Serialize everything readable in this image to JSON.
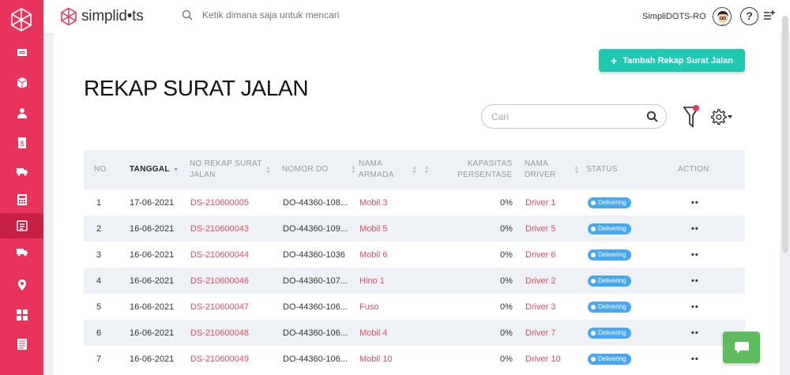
{
  "brand": {
    "name": "simplid•ts"
  },
  "topbar": {
    "search_placeholder": "Ketik dimana saja untuk mencari",
    "user_name": "SimpliDOTS-RO",
    "help_label": "?"
  },
  "page": {
    "title": "REKAP SURAT JALAN",
    "add_button_label": "Tambah Rekap Surat Jalan",
    "search_placeholder": "Cari"
  },
  "table": {
    "headers": {
      "no": "NO",
      "tanggal": "TANGGAL",
      "no_rekap_1": "NO REKAP SURAT",
      "no_rekap_2": "JALAN",
      "nomor_do": "NOMOR DO",
      "armada_1": "NAMA",
      "armada_2": "ARMADA",
      "kapasitas_1": "KAPASITAS",
      "kapasitas_2": "PERSENTASE",
      "driver_1": "NAMA",
      "driver_2": "DRIVER",
      "status": "STATUS",
      "action": "ACTION"
    },
    "rows": [
      {
        "no": "1",
        "tanggal": "17-06-2021",
        "rekap": "DS-210600005",
        "do": "DO-44360-108...",
        "armada": "Mobil 3",
        "kapasitas": "0%",
        "driver": "Driver 1",
        "status": "Delivering",
        "action": "••"
      },
      {
        "no": "2",
        "tanggal": "16-06-2021",
        "rekap": "DS-210600043",
        "do": "DO-44360-109...",
        "armada": "Mobil 5",
        "kapasitas": "0%",
        "driver": "Driver 5",
        "status": "Delivering",
        "action": "••"
      },
      {
        "no": "3",
        "tanggal": "16-06-2021",
        "rekap": "DS-210600044",
        "do": "DO-44360-1036",
        "armada": "Mobil 6",
        "kapasitas": "0%",
        "driver": "Driver 6",
        "status": "Delivering",
        "action": "••"
      },
      {
        "no": "4",
        "tanggal": "16-06-2021",
        "rekap": "DS-210600046",
        "do": "DO-44360-107...",
        "armada": "Hino 1",
        "kapasitas": "0%",
        "driver": "Driver 2",
        "status": "Delivering",
        "action": "••"
      },
      {
        "no": "5",
        "tanggal": "16-06-2021",
        "rekap": "DS-210600047",
        "do": "DO-44360-106...",
        "armada": "Fuso",
        "kapasitas": "0%",
        "driver": "Driver 3",
        "status": "Delivering",
        "action": "••"
      },
      {
        "no": "6",
        "tanggal": "16-06-2021",
        "rekap": "DS-210600048",
        "do": "DO-44360-106...",
        "armada": "Mobil 4",
        "kapasitas": "0%",
        "driver": "Driver 7",
        "status": "Delivering",
        "action": "••"
      },
      {
        "no": "7",
        "tanggal": "16-06-2021",
        "rekap": "DS-210600049",
        "do": "DO-44360-106...",
        "armada": "Mobil 10",
        "kapasitas": "0%",
        "driver": "Driver 10",
        "status": "Delivering",
        "action": "••"
      }
    ]
  },
  "colors": {
    "sidebar": "#e8335a",
    "sidebar_active": "#c81f45",
    "accent_button": "#1ec8b1",
    "link": "#e94b63",
    "badge": "#48a7f0",
    "chat": "#5ebb5e"
  },
  "sidebar_icons": [
    "warehouse-icon",
    "box-icon",
    "user-icon",
    "invoice-icon",
    "truck-icon",
    "calculator-icon",
    "delivery-recap-icon",
    "truck-alt-icon",
    "location-pin-icon",
    "grid-icon",
    "document-list-icon"
  ]
}
